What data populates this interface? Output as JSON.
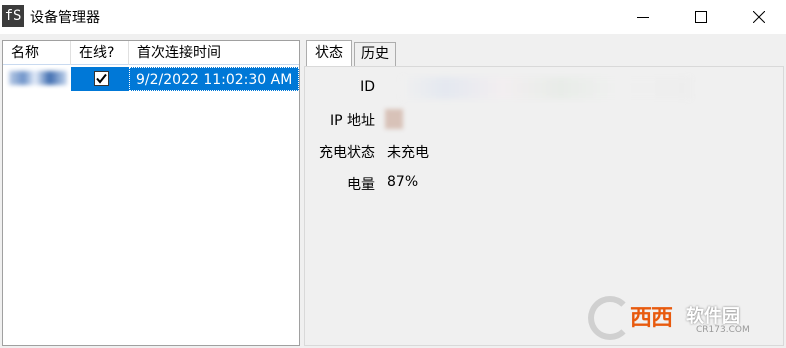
{
  "window": {
    "app_icon_text": "fS",
    "title": "设备管理器"
  },
  "device_list": {
    "columns": [
      "名称",
      "在线?",
      "首次连接时间"
    ],
    "rows": [
      {
        "name": "",
        "online": true,
        "first_connected": "9/2/2022 11:02:30 AM"
      }
    ]
  },
  "tabs": [
    {
      "label": "状态",
      "active": true
    },
    {
      "label": "历史",
      "active": false
    }
  ],
  "status": {
    "id_label": "ID",
    "ip_label": "IP 地址",
    "charge_label": "充电状态",
    "charge_value": "未充电",
    "battery_label": "电量",
    "battery_value": "87%"
  },
  "watermark": {
    "text": "西西",
    "text2": "软件园",
    "sub": "CR173.COM"
  },
  "colors": {
    "selection": "#0078d7",
    "background": "#f0f0f0",
    "watermark_orange": "#e85a0e"
  }
}
